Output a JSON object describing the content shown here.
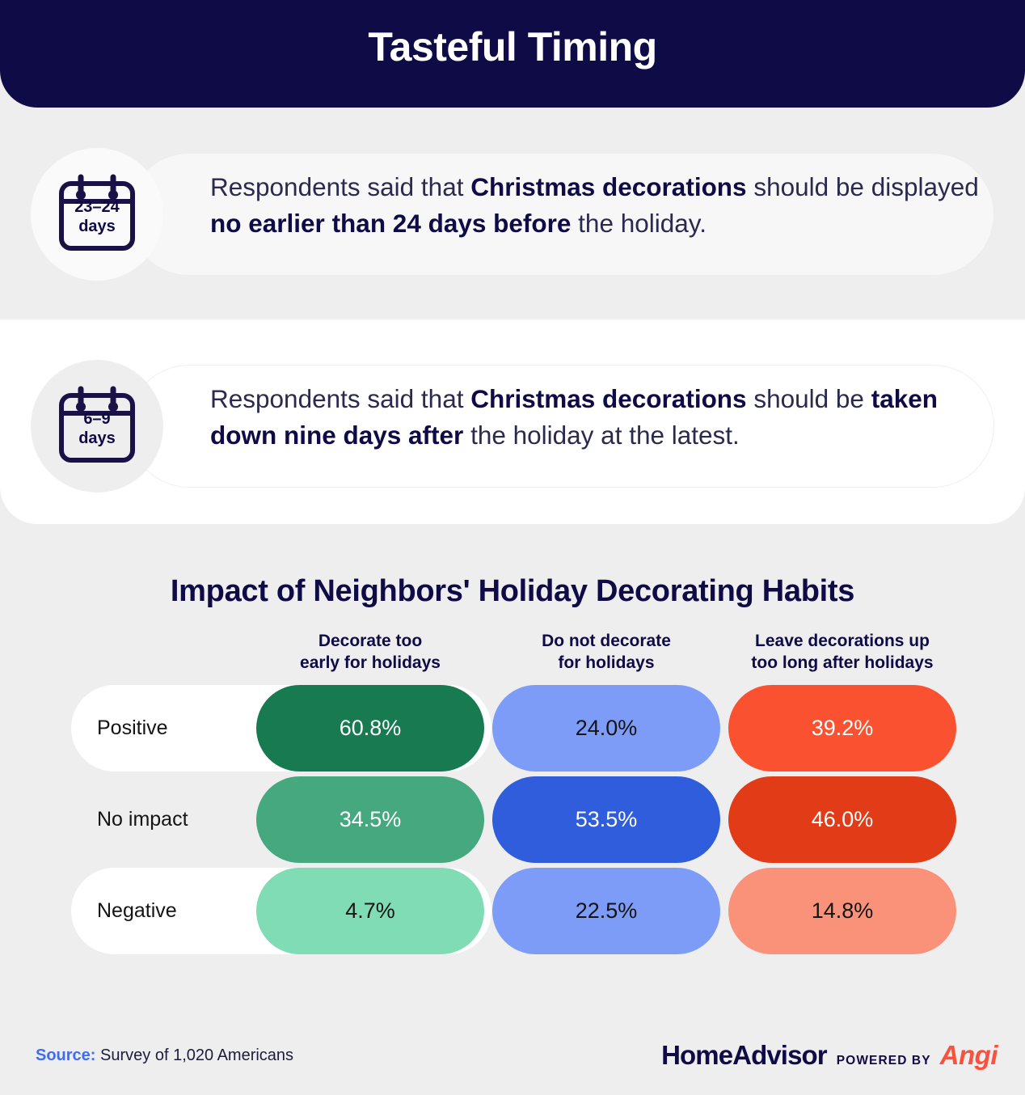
{
  "header": {
    "title": "Tasteful Timing"
  },
  "stats": [
    {
      "icon_name": "calendar-icon",
      "icon_range": "23–24",
      "icon_unit": "days",
      "text_parts": [
        {
          "t": "Respondents said that ",
          "bold": false
        },
        {
          "t": "Christmas decorations",
          "bold": true
        },
        {
          "t": " should be displayed ",
          "bold": false
        },
        {
          "t": "no earlier than 24 days before",
          "bold": true
        },
        {
          "t": " the holiday.",
          "bold": false
        }
      ]
    },
    {
      "icon_name": "calendar-icon",
      "icon_range": "6–9",
      "icon_unit": "days",
      "text_parts": [
        {
          "t": "Respondents said that ",
          "bold": false
        },
        {
          "t": "Christmas decorations",
          "bold": true
        },
        {
          "t": " should be ",
          "bold": false
        },
        {
          "t": "taken down nine days after",
          "bold": true
        },
        {
          "t": " the holiday at the latest.",
          "bold": false
        }
      ]
    }
  ],
  "chart_data": {
    "type": "heatmap",
    "title": "Impact of Neighbors' Holiday Decorating Habits",
    "xlabel": "",
    "ylabel": "",
    "legend": "none",
    "grid": false,
    "categories": [
      "Decorate too early for holidays",
      "Do not decorate for holidays",
      "Leave decorations up too long after holidays"
    ],
    "categories_lines": [
      [
        "Decorate too",
        "early for holidays"
      ],
      [
        "Do not decorate",
        "for holidays"
      ],
      [
        "Leave decorations up",
        "too long after holidays"
      ]
    ],
    "rows": [
      "Positive",
      "No impact",
      "Negative"
    ],
    "series": [
      {
        "name": "Decorate too early for holidays",
        "values": [
          60.8,
          34.5,
          4.7
        ]
      },
      {
        "name": "Do not decorate for holidays",
        "values": [
          24.0,
          53.5,
          22.5
        ]
      },
      {
        "name": "Leave decorations up too long after holidays",
        "values": [
          39.2,
          46.0,
          14.8
        ]
      }
    ],
    "cells": [
      [
        {
          "value": "60.8%",
          "color": "#177a51",
          "text_color": "#ffffff"
        },
        {
          "value": "24.0%",
          "color": "#7c9cf8",
          "text_color": "#141414"
        },
        {
          "value": "39.2%",
          "color": "#fa5130",
          "text_color": "#ffffff"
        }
      ],
      [
        {
          "value": "34.5%",
          "color": "#46a87e",
          "text_color": "#ffffff"
        },
        {
          "value": "53.5%",
          "color": "#2f5ddb",
          "text_color": "#ffffff"
        },
        {
          "value": "46.0%",
          "color": "#e23b18",
          "text_color": "#ffffff"
        }
      ],
      [
        {
          "value": "4.7%",
          "color": "#7fdcb4",
          "text_color": "#141414"
        },
        {
          "value": "22.5%",
          "color": "#7c9cf8",
          "text_color": "#141414"
        },
        {
          "value": "14.8%",
          "color": "#fa9279",
          "text_color": "#141414"
        }
      ]
    ],
    "ylim": [
      0,
      100
    ],
    "units": "percent"
  },
  "footer": {
    "source_label": "Source:",
    "source_text": " Survey of 1,020 Americans",
    "logo_home": "HomeAdvisor",
    "logo_powered": "POWERED BY",
    "logo_angi": "Angi"
  },
  "colors": {
    "header_bg": "#0e0b47",
    "page_bg": "#eeeeee",
    "accent_blue": "#3b6ef5",
    "accent_coral": "#fc4f3c"
  }
}
